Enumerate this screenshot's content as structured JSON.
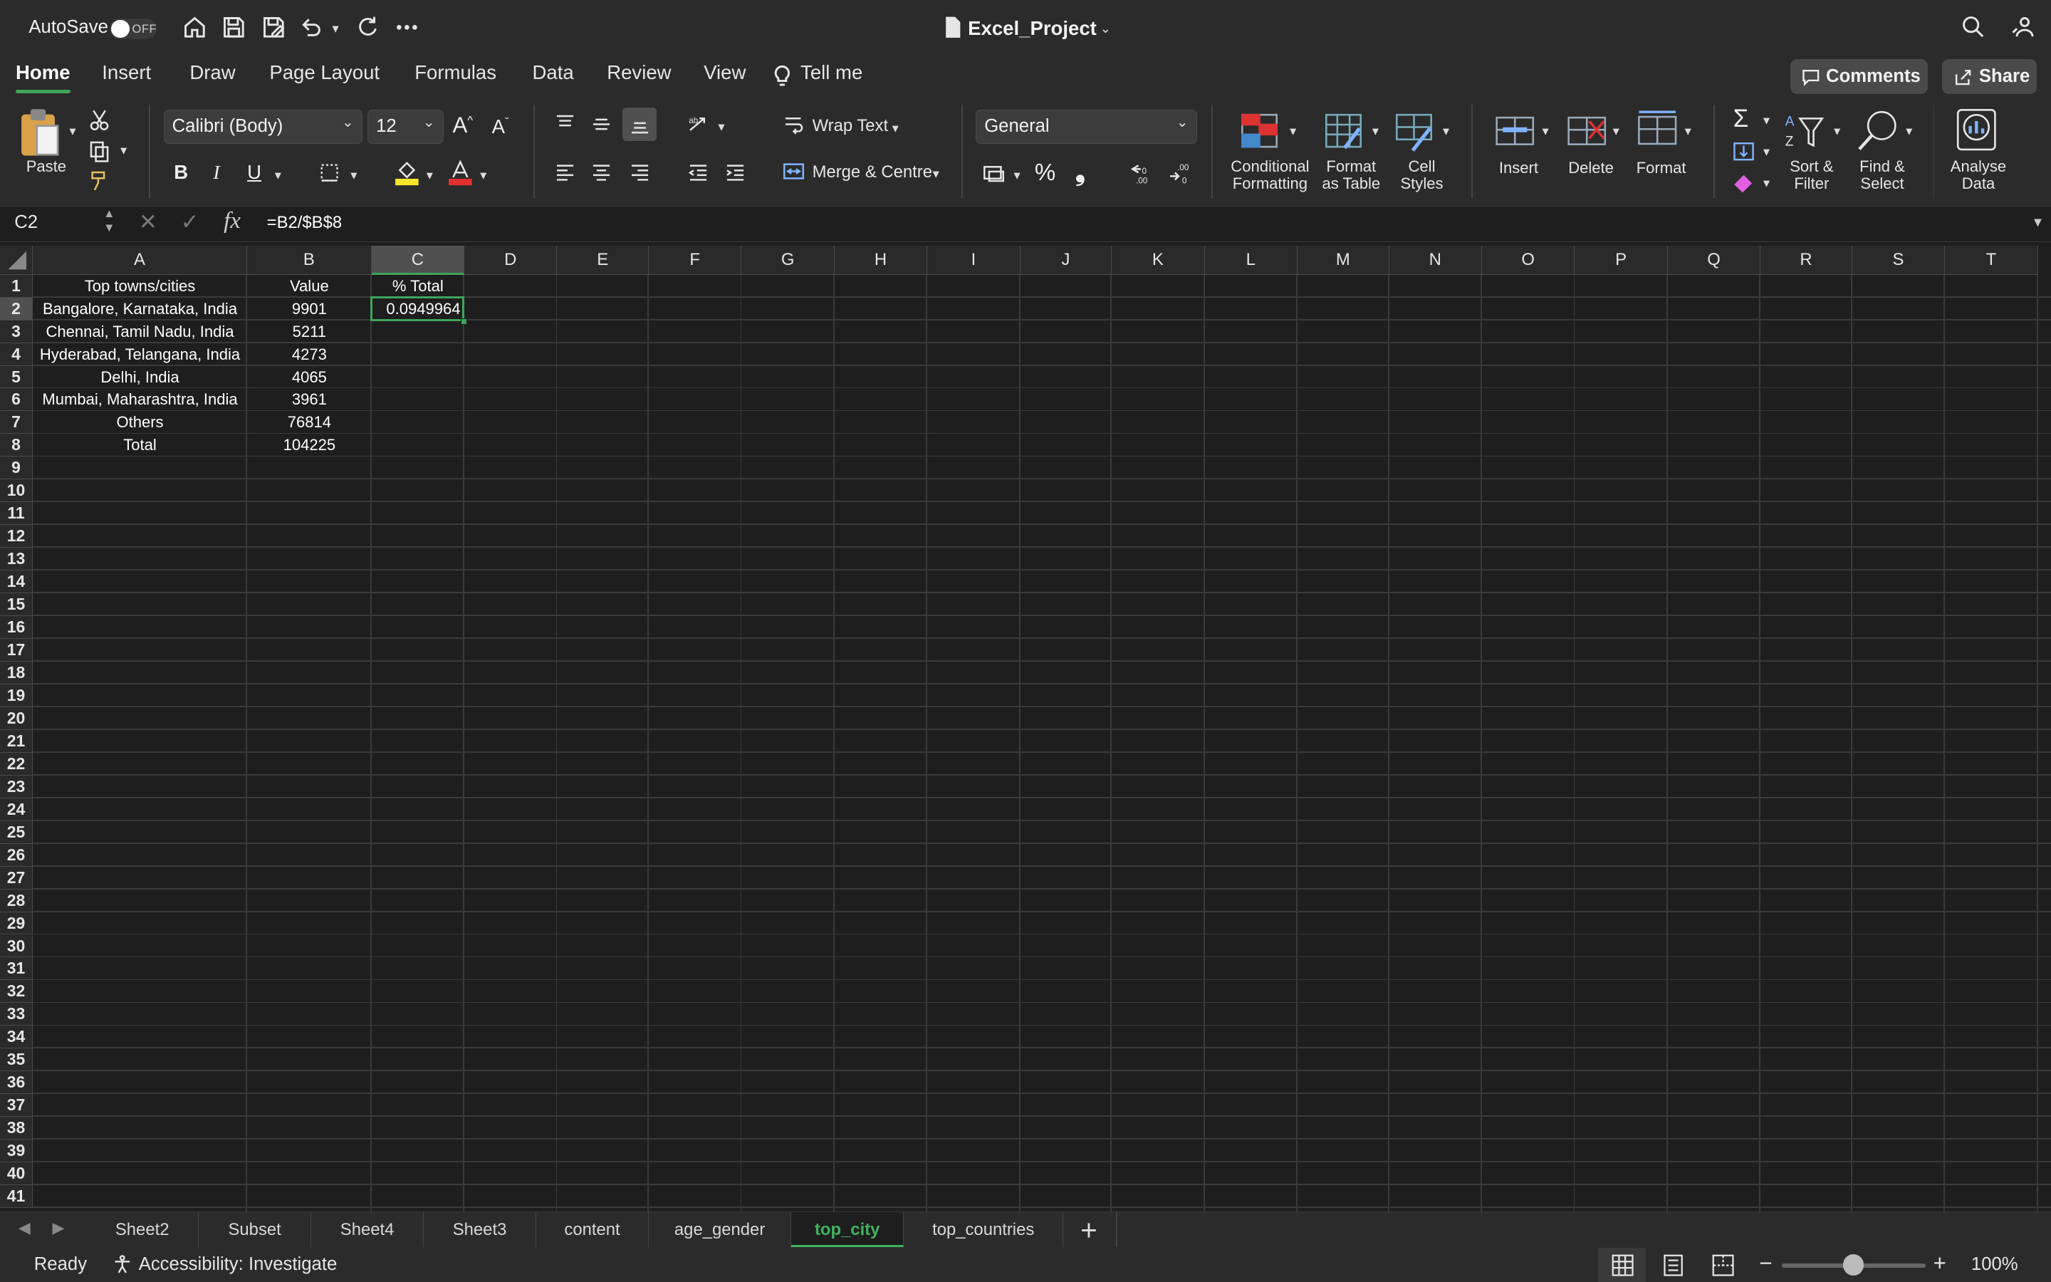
{
  "title_bar": {
    "autosave_label": "AutoSave",
    "autosave_state": "OFF",
    "document_title": "Excel_Project"
  },
  "ribbon_tabs": [
    "Home",
    "Insert",
    "Draw",
    "Page Layout",
    "Formulas",
    "Data",
    "Review",
    "View"
  ],
  "tell_me": "Tell me",
  "comments_label": "Comments",
  "share_label": "Share",
  "ribbon": {
    "paste": "Paste",
    "font_name": "Calibri (Body)",
    "font_size": "12",
    "bold": "B",
    "italic": "I",
    "underline": "U",
    "wrap_text": "Wrap Text",
    "merge_centre": "Merge & Centre",
    "number_format": "General",
    "percent": "%",
    "comma": "❟",
    "conditional_formatting": [
      "Conditional",
      "Formatting"
    ],
    "format_as_table": [
      "Format",
      "as Table"
    ],
    "cell_styles": [
      "Cell",
      "Styles"
    ],
    "insert": "Insert",
    "delete": "Delete",
    "format": "Format",
    "sort_filter": [
      "Sort &",
      "Filter"
    ],
    "find_select": [
      "Find &",
      "Select"
    ],
    "analyse_data": [
      "Analyse",
      "Data"
    ]
  },
  "formula_bar": {
    "name_box": "C2",
    "fx": "fx",
    "formula": "=B2/$B$8"
  },
  "columns": [
    "A",
    "B",
    "C",
    "D",
    "E",
    "F",
    "G",
    "H",
    "I",
    "J",
    "K",
    "L",
    "M",
    "N",
    "O",
    "P",
    "Q",
    "R",
    "S",
    "T"
  ],
  "row_count": 41,
  "cells": {
    "A1": "Top towns/cities",
    "B1": "Value",
    "C1": "% Total",
    "A2": "Bangalore, Karnataka, India",
    "B2": "9901",
    "C2": "0.0949964",
    "A3": "Chennai, Tamil Nadu, India",
    "B3": "5211",
    "A4": "Hyderabad, Telangana, India",
    "B4": "4273",
    "A5": "Delhi, India",
    "B5": "4065",
    "A6": "Mumbai, Maharashtra, India",
    "B6": "3961",
    "A7": "Others",
    "B7": "76814",
    "A8": "Total",
    "B8": "104225"
  },
  "sheet_tabs": [
    "Sheet2",
    "Subset",
    "Sheet4",
    "Sheet3",
    "content",
    "age_gender",
    "top_city",
    "top_countries"
  ],
  "active_sheet": "top_city",
  "status": {
    "ready": "Ready",
    "accessibility": "Accessibility: Investigate",
    "zoom": "100%"
  },
  "colors": {
    "accent_green": "#3fa45b",
    "background": "#1e1e1e",
    "chrome": "#2b2b2b"
  }
}
